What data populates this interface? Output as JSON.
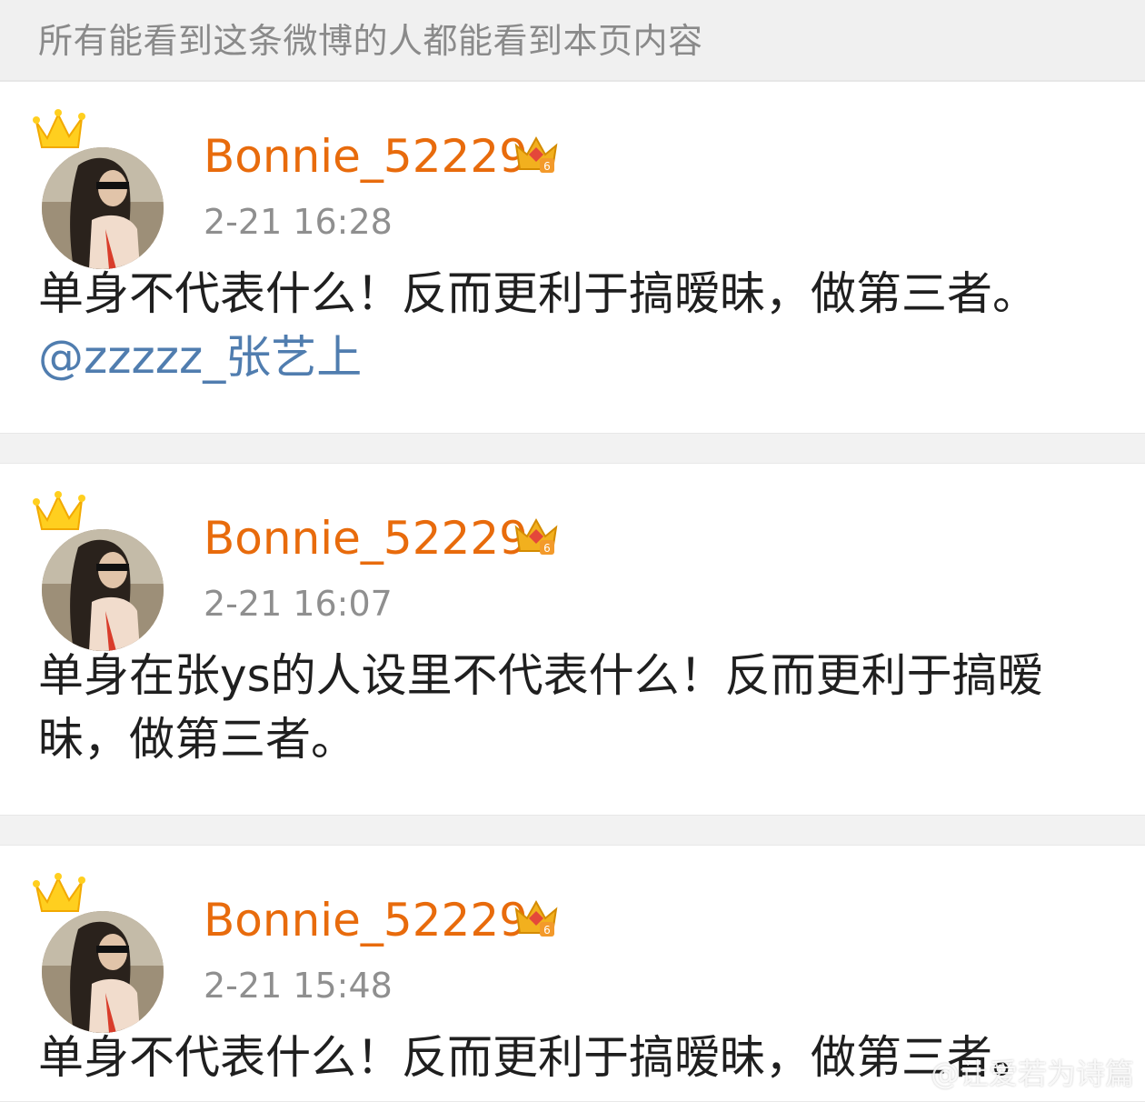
{
  "notice": {
    "text": "所有能看到这条微博的人都能看到本页内容"
  },
  "posts": [
    {
      "username": "Bonnie_52229",
      "time": "2-21 16:28",
      "text": "单身不代表什么！反而更利于搞暧昧，做第三者。",
      "mention": "@zzzzz_张艺上"
    },
    {
      "username": "Bonnie_52229",
      "time": "2-21 16:07",
      "text": "单身在张ys的人设里不代表什么！反而更利于搞暧昧，做第三者。"
    },
    {
      "username": "Bonnie_52229",
      "time": "2-21 15:48",
      "text": "单身不代表什么！反而更利于搞暧昧，做第三者。"
    }
  ],
  "watermark": {
    "text": "@让爱若为诗篇"
  },
  "icons": {
    "crown": "vip-crown-icon",
    "member_badge": "member-level-badge-icon",
    "avatar": "user-avatar"
  },
  "colors": {
    "username": "#e86b0c",
    "mention": "#507daf",
    "timestamp": "#8f8f8f",
    "text": "#1f1f1f"
  }
}
